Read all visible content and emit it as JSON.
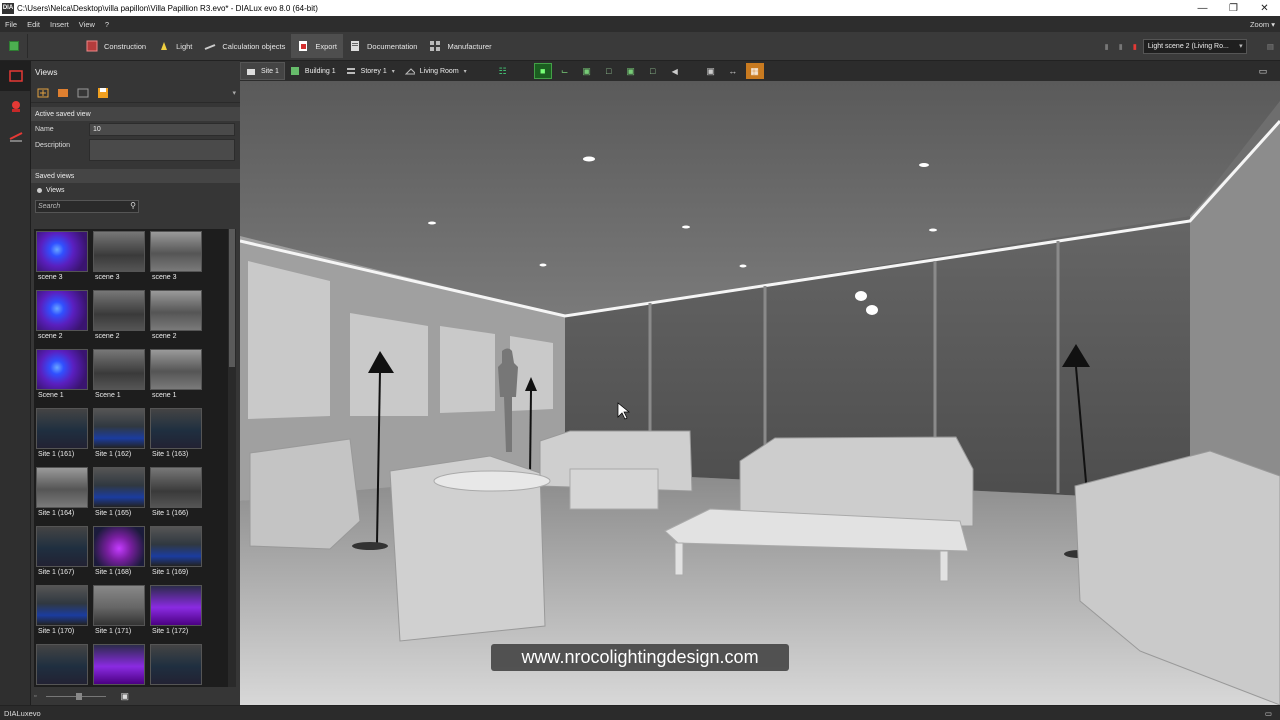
{
  "window": {
    "title": "C:\\Users\\Nelca\\Desktop\\villa papillon\\Villa Papillion R3.evo* - DIALux evo 8.0  (64-bit)",
    "app_icon_text": "DIA"
  },
  "menu": {
    "items": [
      "File",
      "Edit",
      "Insert",
      "View",
      "?"
    ],
    "zoom": "Zoom"
  },
  "toolbar": {
    "items": [
      {
        "label": "Construction",
        "icon": "construction-icon"
      },
      {
        "label": "Light",
        "icon": "light-icon"
      },
      {
        "label": "Calculation objects",
        "icon": "calculation-icon"
      },
      {
        "label": "Export",
        "icon": "export-icon"
      },
      {
        "label": "Documentation",
        "icon": "documentation-icon"
      },
      {
        "label": "Manufacturer",
        "icon": "manufacturer-icon"
      }
    ],
    "light_scene": "Light scene 2 (Living Ro..."
  },
  "panel": {
    "header": "Views",
    "active_saved_view": "Active saved view",
    "name_label": "Name",
    "name_value": "10",
    "description_label": "Description",
    "saved_views": "Saved views",
    "views_tab": "Views",
    "search_placeholder": "Search",
    "thumbnails": [
      {
        "caption": "scene 3",
        "style": "blue"
      },
      {
        "caption": "scene 3",
        "style": "gray"
      },
      {
        "caption": "scene 3",
        "style": "gray2"
      },
      {
        "caption": "scene 2",
        "style": "blue"
      },
      {
        "caption": "scene 2",
        "style": "gray"
      },
      {
        "caption": "scene 2",
        "style": "gray2"
      },
      {
        "caption": "Scene 1",
        "style": "blue"
      },
      {
        "caption": "Scene 1",
        "style": "gray"
      },
      {
        "caption": "scene 1",
        "style": "gray2"
      },
      {
        "caption": "Site 1 (161)",
        "style": "night"
      },
      {
        "caption": "Site 1 (162)",
        "style": "pool"
      },
      {
        "caption": "Site 1 (163)",
        "style": "night"
      },
      {
        "caption": "Site 1 (164)",
        "style": "gray2"
      },
      {
        "caption": "Site 1 (165)",
        "style": "pool"
      },
      {
        "caption": "Site 1 (166)",
        "style": "gray"
      },
      {
        "caption": "Site 1 (167)",
        "style": "night"
      },
      {
        "caption": "Site 1 (168)",
        "style": "purple"
      },
      {
        "caption": "Site 1 (169)",
        "style": "pool"
      },
      {
        "caption": "Site 1 (170)",
        "style": "pool"
      },
      {
        "caption": "Site 1 (171)",
        "style": "wide"
      },
      {
        "caption": "Site 1 (172)",
        "style": "purple2"
      },
      {
        "caption": "",
        "style": "night"
      },
      {
        "caption": "",
        "style": "purple2"
      },
      {
        "caption": "",
        "style": "night"
      }
    ]
  },
  "viewbar": {
    "site": "Site 1",
    "building": "Building 1",
    "storey": "Storey 1",
    "room": "Living Room"
  },
  "watermark": "www.nrocolightingdesign.com",
  "status": "DIALuxevo"
}
